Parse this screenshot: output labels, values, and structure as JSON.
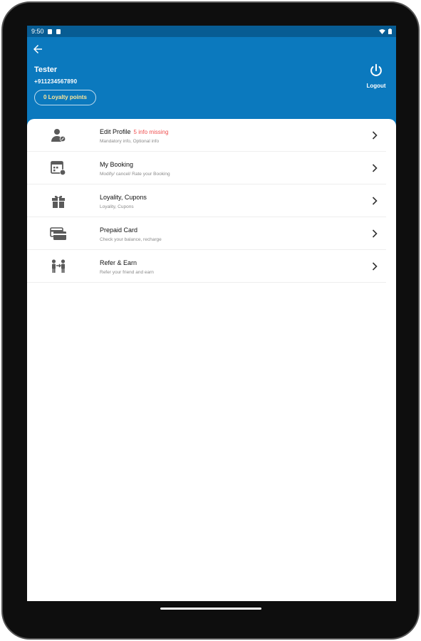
{
  "status_bar": {
    "time": "9:50",
    "icons": [
      "sim-icon",
      "notification-icon",
      "wifi-icon",
      "battery-icon"
    ]
  },
  "header": {
    "back_icon": "arrow-left-icon",
    "user_name": "Tester",
    "phone": "+911234567890",
    "loyalty_points": "0 Loyalty points",
    "logout_label": "Logout",
    "logout_icon": "power-icon"
  },
  "menu": {
    "items": [
      {
        "title": "Edit Profile",
        "badge": "5 info missing",
        "subtitle": "Mandatory info, Optional info",
        "icon": "user-edit-icon"
      },
      {
        "title": "My Booking",
        "badge": "",
        "subtitle": "Modify/ cancel/ Rate your Booking",
        "icon": "calendar-icon"
      },
      {
        "title": "Loyality, Cupons",
        "badge": "",
        "subtitle": "Loyality, Cupons",
        "icon": "gift-icon"
      },
      {
        "title": "Prepaid Card",
        "badge": "",
        "subtitle": "Check your balance, recharge",
        "icon": "card-icon"
      },
      {
        "title": "Refer & Earn",
        "badge": "",
        "subtitle": "Refer your friend and earn",
        "icon": "people-icon"
      }
    ]
  },
  "colors": {
    "status_bar": "#075c93",
    "header": "#0b79be",
    "badge": "#ef4f4f",
    "loyalty_text": "#ffe89a",
    "icon": "#5a5a5a"
  }
}
